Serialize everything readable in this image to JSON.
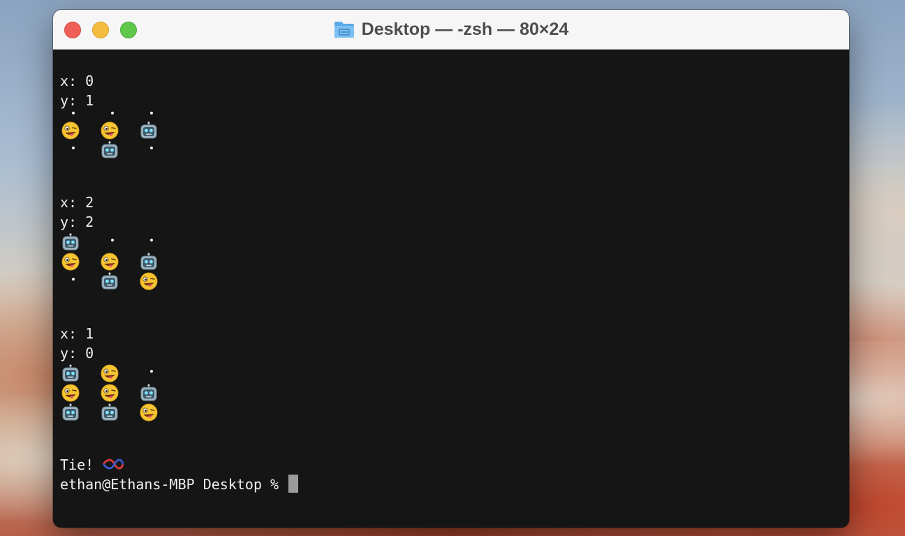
{
  "window": {
    "title": "Desktop — -zsh — 80×24",
    "folder_icon": "folder-icon"
  },
  "terminal": {
    "rounds": [
      {
        "x_line": "x: 0",
        "y_line": "y: 1",
        "board": [
          [
            "🤪",
            "🤪",
            "🤖"
          ],
          [
            "·",
            "🤖",
            "·"
          ]
        ],
        "top_markers": [
          ".",
          ".",
          "."
        ]
      },
      {
        "x_line": "x: 2",
        "y_line": "y: 2",
        "board": [
          [
            "🤖",
            "·",
            "·"
          ],
          [
            "🤪",
            "🤪",
            "🤖"
          ],
          [
            "·",
            "🤖",
            "🤪"
          ]
        ]
      },
      {
        "x_line": "x: 1",
        "y_line": "y: 0",
        "board": [
          [
            "🤖",
            "🤪",
            "·"
          ],
          [
            "🤪",
            "🤪",
            "🤖"
          ],
          [
            "🤖",
            "🤖",
            "🤪"
          ]
        ]
      }
    ],
    "result_text": "Tie! ",
    "result_icon": "knot-icon",
    "prompt": "ethan@Ethans-MBP Desktop % "
  },
  "colors": {
    "terminal_bg": "#151515",
    "terminal_fg": "#f0f0f0",
    "cursor": "#9b9b9b"
  }
}
